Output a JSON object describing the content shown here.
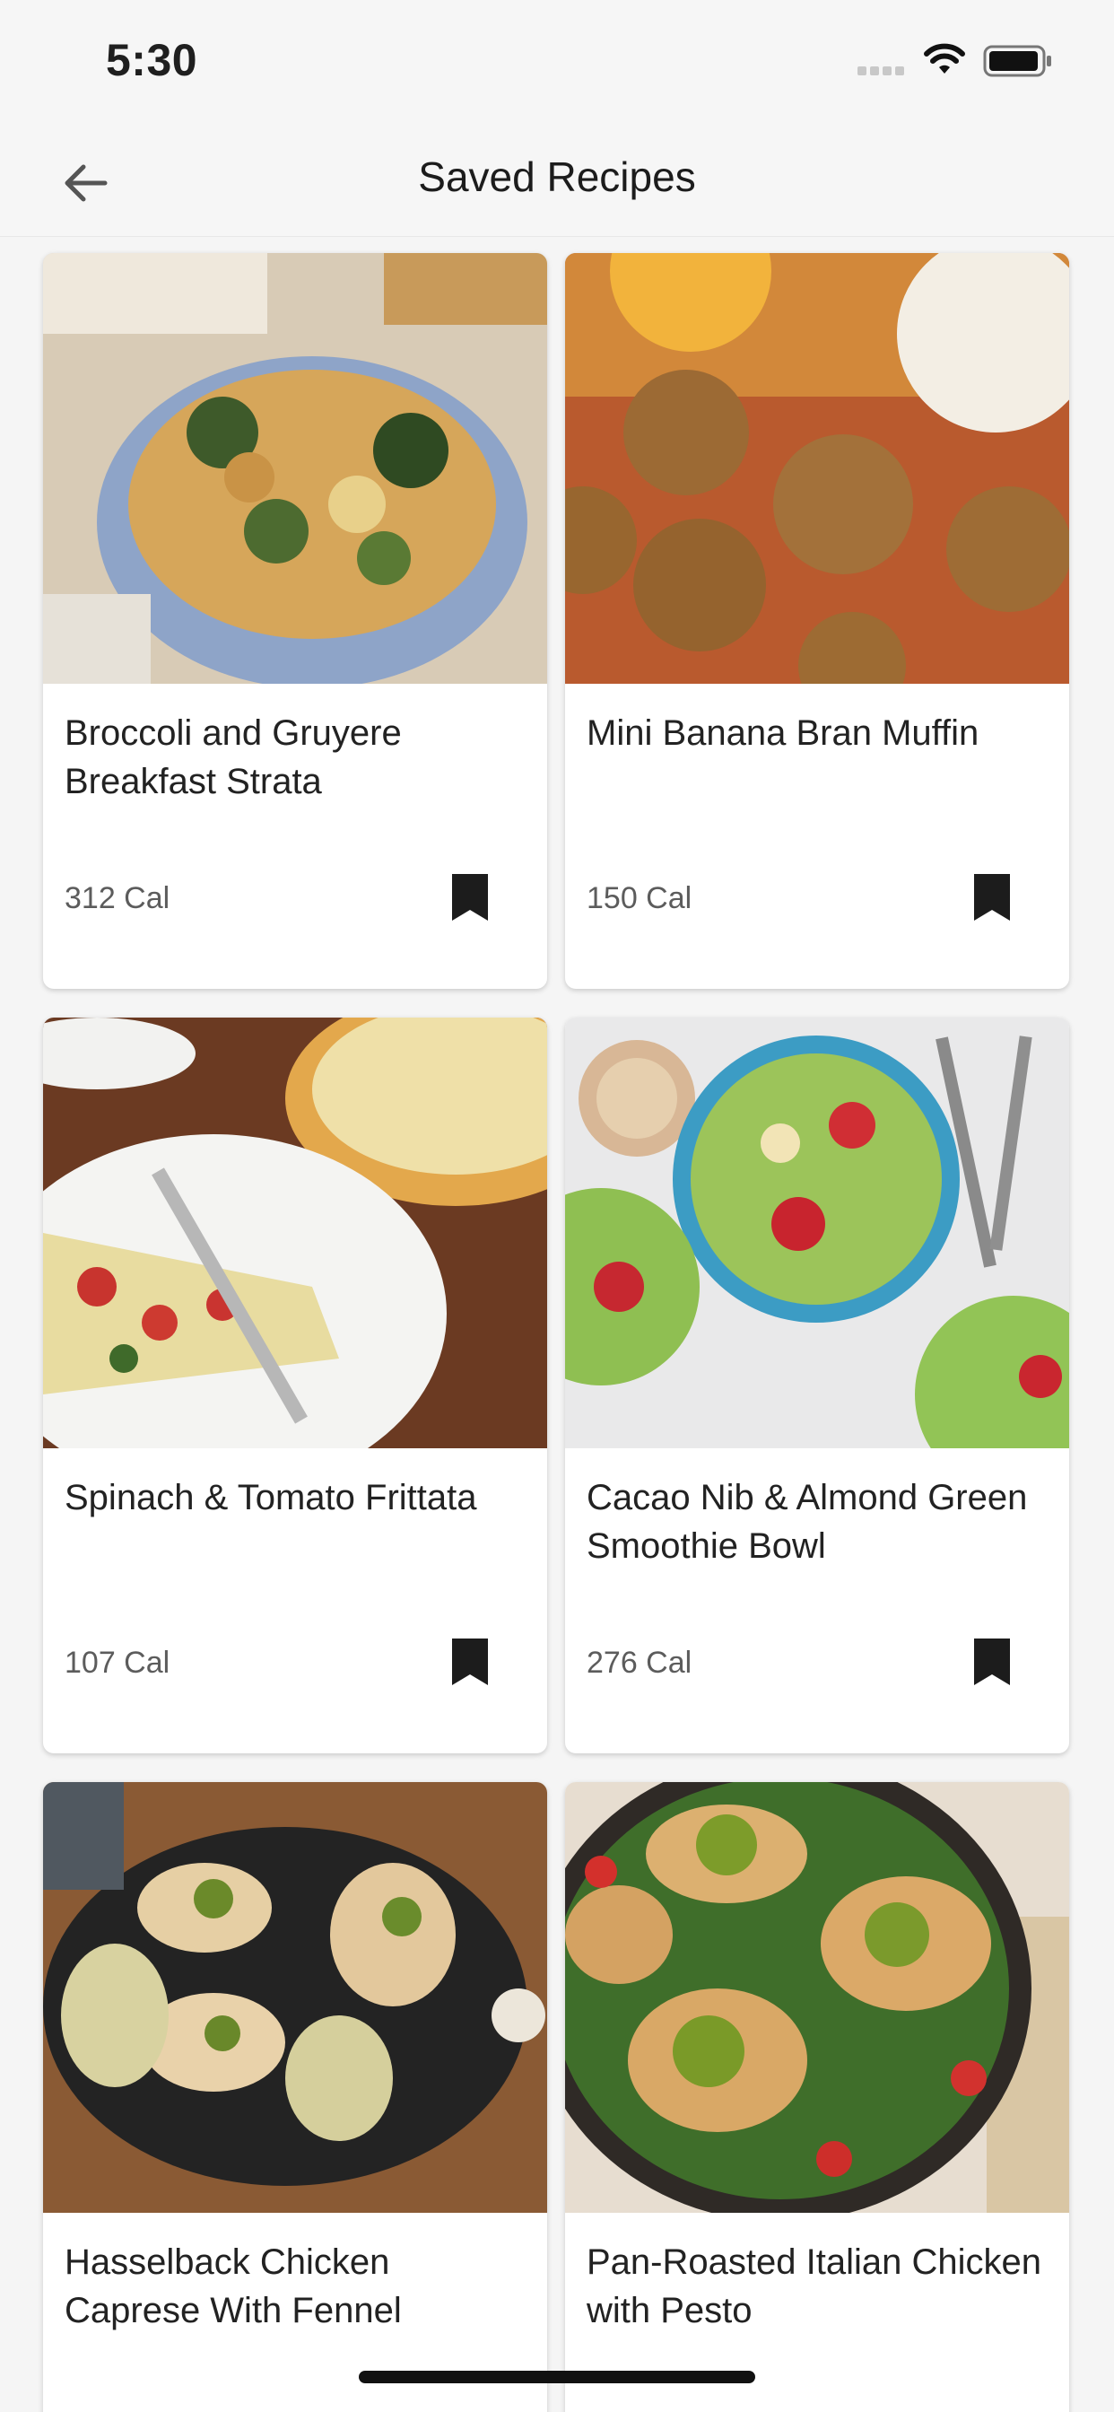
{
  "status_bar": {
    "time": "5:30"
  },
  "header": {
    "title": "Saved Recipes"
  },
  "recipes": [
    {
      "title": "Broccoli and Gruyere Breakfast Strata",
      "calories": "312 Cal"
    },
    {
      "title": "Mini Banana Bran Muffin",
      "calories": "150 Cal"
    },
    {
      "title": "Spinach & Tomato Frittata",
      "calories": "107 Cal"
    },
    {
      "title": "Cacao Nib & Almond Green Smoothie Bowl",
      "calories": "276 Cal"
    },
    {
      "title": "Hasselback Chicken Caprese With Fennel",
      "calories": ""
    },
    {
      "title": "Pan-Roasted Italian Chicken with Pesto",
      "calories": ""
    }
  ],
  "icons": {
    "back": "arrow-left-icon",
    "bookmark": "bookmark-icon",
    "wifi": "wifi-icon",
    "battery": "battery-icon"
  }
}
